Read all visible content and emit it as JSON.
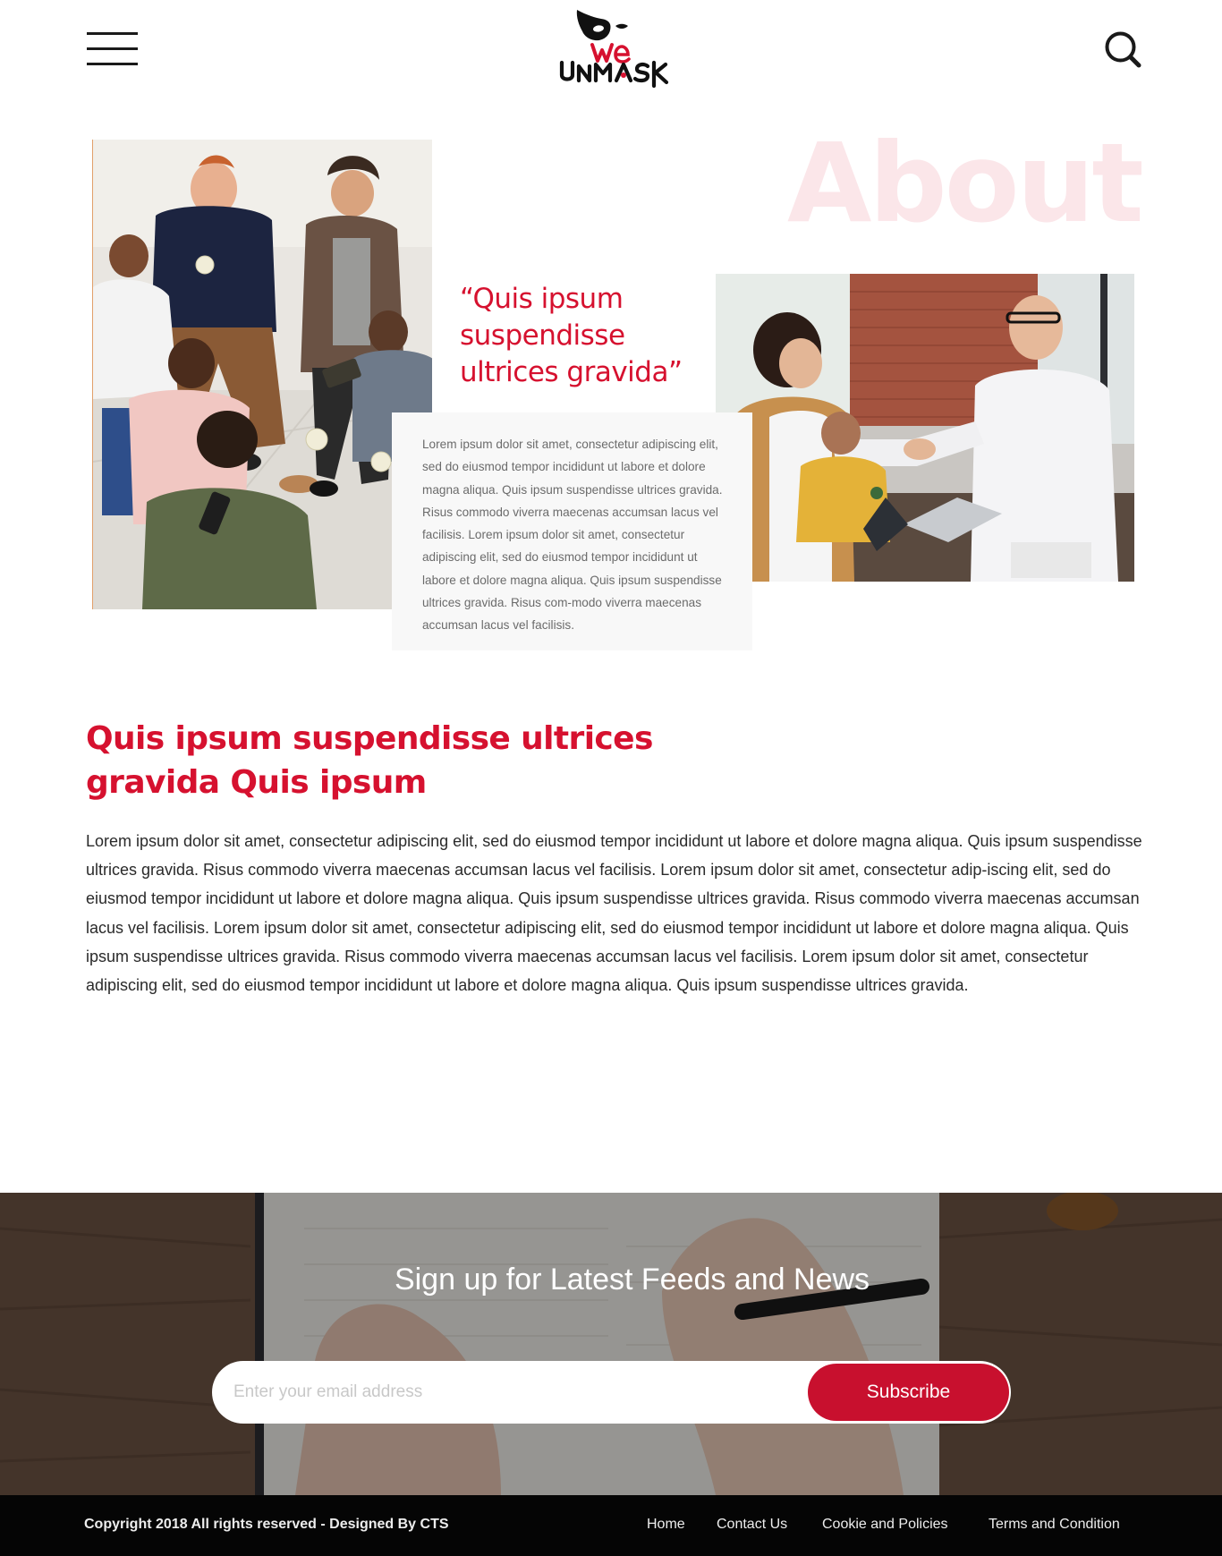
{
  "header": {
    "menu_icon": "hamburger-menu-icon",
    "logo_text_top": "We",
    "logo_text_bottom": "UNMASK",
    "search_icon": "search-icon"
  },
  "about": {
    "title": "About",
    "quote": "“Quis ipsum suspendisse ultrices gravida”",
    "card_text": "Lorem ipsum dolor sit amet, consectetur adipiscing elit, sed do eiusmod tempor incididunt ut labore et dolore magna aliqua. Quis ipsum suspendisse ultrices gravida. Risus commodo viverra maecenas accumsan lacus vel facilisis. Lorem ipsum dolor sit amet, consectetur adipiscing elit, sed do eiusmod tempor incididunt ut labore et dolore magna aliqua. Quis ipsum suspendisse ultrices gravida. Risus com-modo viverra maecenas accumsan lacus vel facilisis."
  },
  "article": {
    "title": "Quis ipsum suspendisse ultrices gravida Quis ipsum",
    "body": "Lorem ipsum dolor sit amet, consectetur adipiscing elit, sed do eiusmod tempor incididunt ut labore et dolore magna aliqua. Quis ipsum suspendisse ultrices gravida. Risus commodo viverra maecenas accumsan lacus vel facilisis. Lorem ipsum dolor sit amet, consectetur adip-iscing elit, sed do eiusmod tempor incididunt ut labore et dolore magna aliqua. Quis ipsum suspendisse ultrices gravida. Risus commodo viverra maecenas accumsan lacus vel facilisis. Lorem ipsum dolor sit amet, consectetur adipiscing elit, sed do eiusmod tempor incididunt ut labore et dolore magna aliqua. Quis ipsum suspendisse ultrices gravida. Risus commodo viverra maecenas accumsan lacus vel facilisis. Lorem ipsum dolor sit amet, consectetur adipiscing elit, sed do eiusmod tempor incididunt ut labore et dolore magna aliqua. Quis ipsum suspendisse ultrices gravida."
  },
  "newsletter": {
    "title": "Sign up for Latest Feeds and News",
    "email_placeholder": "Enter your email address",
    "email_value": "",
    "subscribe_label": "Subscribe"
  },
  "footer": {
    "copyright": "Copyright 2018 All rights reserved - Designed By CTS",
    "links": [
      "Home",
      "Contact Us",
      "Cookie and Policies",
      "Terms and Condition"
    ]
  },
  "colors": {
    "accent": "#d6112f",
    "button": "#c8102e",
    "footer_bg": "#050505",
    "about_watermark": "#fbe6e9",
    "card_bg": "#f8f8f8"
  }
}
